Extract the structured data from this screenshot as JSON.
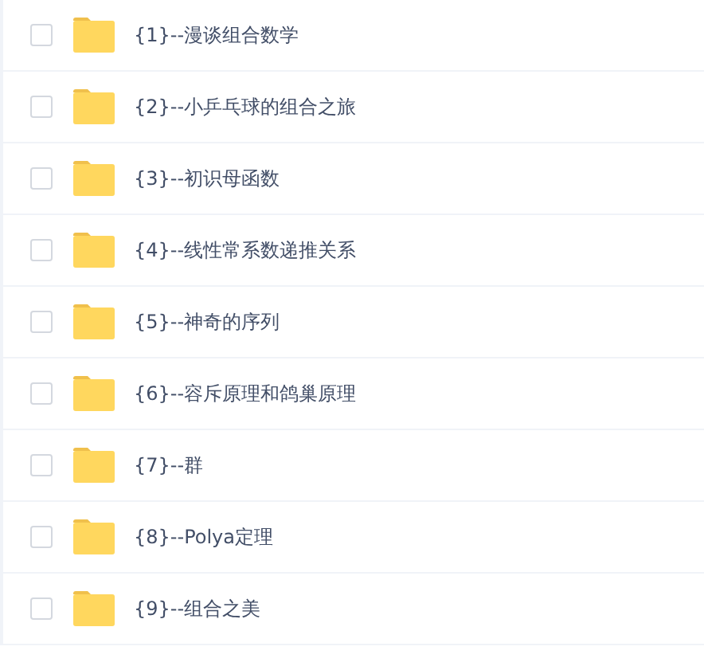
{
  "files": [
    {
      "name": "{1}--漫谈组合数学",
      "checked": false
    },
    {
      "name": "{2}--小乒乓球的组合之旅",
      "checked": false
    },
    {
      "name": "{3}--初识母函数",
      "checked": false
    },
    {
      "name": "{4}--线性常系数递推关系",
      "checked": false
    },
    {
      "name": "{5}--神奇的序列",
      "checked": false
    },
    {
      "name": "{6}--容斥原理和鸽巢原理",
      "checked": false
    },
    {
      "name": "{7}--群",
      "checked": false
    },
    {
      "name": "{8}--Polya定理",
      "checked": false
    },
    {
      "name": "{9}--组合之美",
      "checked": false
    }
  ]
}
